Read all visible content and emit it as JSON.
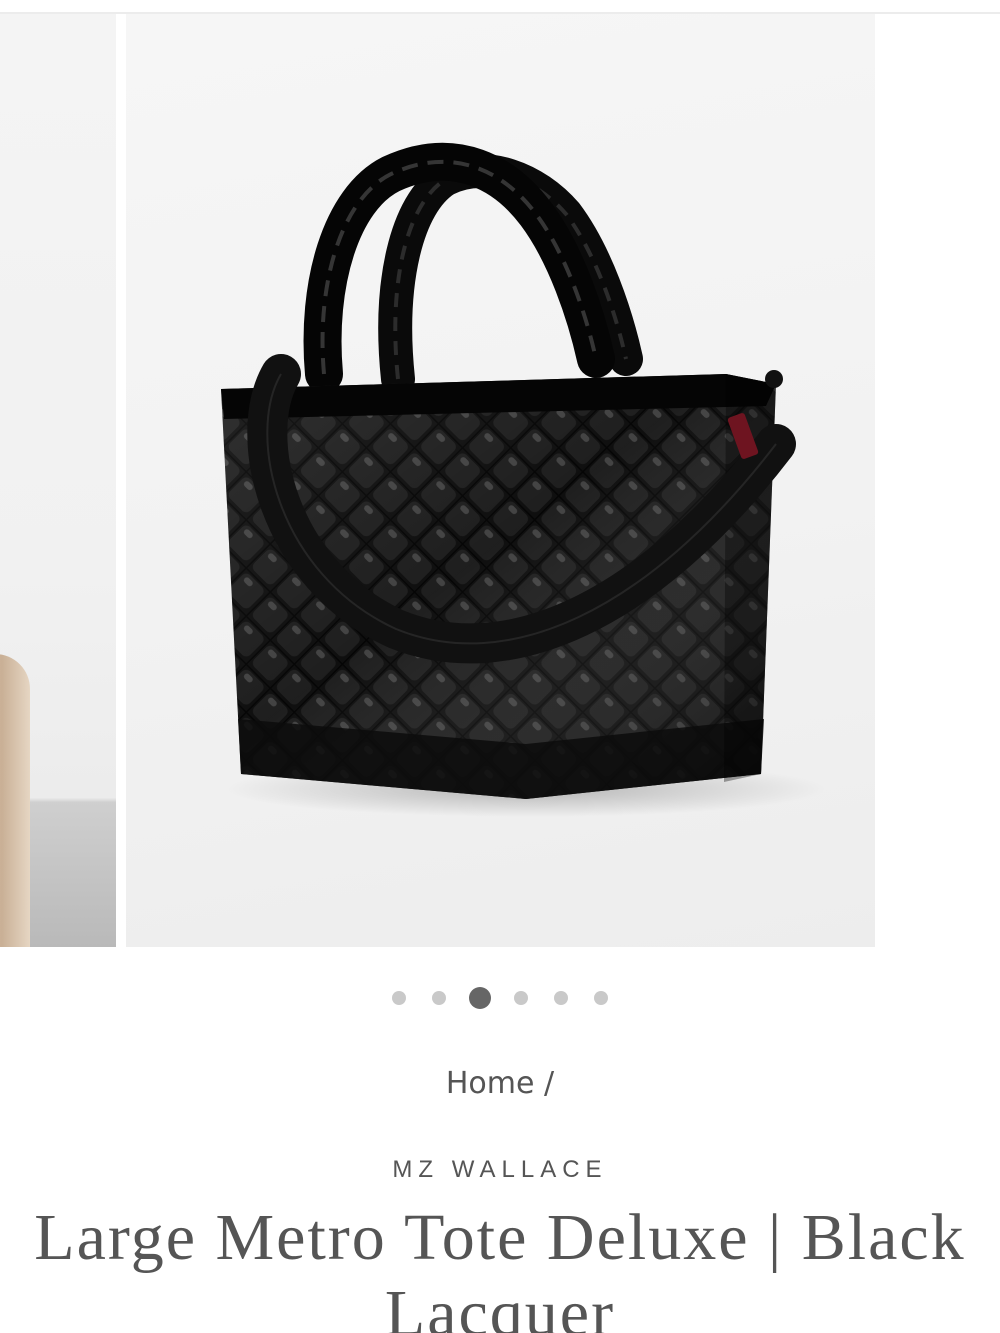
{
  "gallery": {
    "slide_count": 6,
    "active_index": 2,
    "zoom_icon": "magnifier-icon",
    "main_image_alt": "Large Metro Tote Deluxe in Black Lacquer"
  },
  "breadcrumb": {
    "home_label": "Home",
    "separator": "/"
  },
  "product": {
    "brand": "MZ WALLACE",
    "title": "Large Metro Tote Deluxe | Black Lacquer"
  },
  "colors": {
    "text": "#555555",
    "dot_inactive": "#c9c9c9",
    "dot_active": "#666666",
    "bag": "#0b0b0b"
  }
}
